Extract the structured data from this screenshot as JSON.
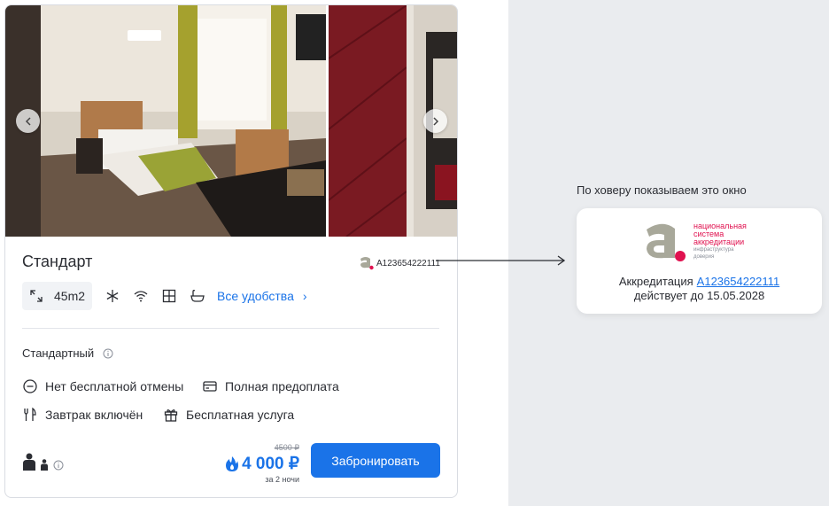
{
  "hover_note": {
    "title": "По ховеру показываем это окно"
  },
  "room": {
    "title": "Стандарт",
    "accreditation_code": "A123654222111",
    "area": "45m2",
    "amenities_icons": [
      "snowflake-icon",
      "wifi-icon",
      "safe-icon",
      "bath-icon"
    ],
    "all_amenities_label": "Все удобства",
    "tariff_name": "Стандартный",
    "conditions": [
      {
        "icon": "no-entry-icon",
        "label": "Нет бесплатной отмены"
      },
      {
        "icon": "card-icon",
        "label": "Полная предоплата"
      },
      {
        "icon": "fork-knife-icon",
        "label": "Завтрак включён"
      },
      {
        "icon": "gift-icon",
        "label": "Бесплатная услуга"
      }
    ],
    "old_price": "4500 ₽",
    "price": "4 000 ₽",
    "nights": "за 2 ночи",
    "book_label": "Забронировать"
  },
  "popup": {
    "logo_lines": [
      "национальная",
      "система",
      "аккредитации"
    ],
    "logo_sub_lines": [
      "инфраструктура",
      "доверия"
    ],
    "accreditation_label": "Аккредитация",
    "accreditation_code": "A123654222111",
    "valid_until": "действует до 15.05.2028"
  },
  "colors": {
    "accent": "#1a73e8",
    "brand_red": "#e0114f",
    "logo_gray": "#a8a89a",
    "panel_bg": "#eaecef"
  }
}
